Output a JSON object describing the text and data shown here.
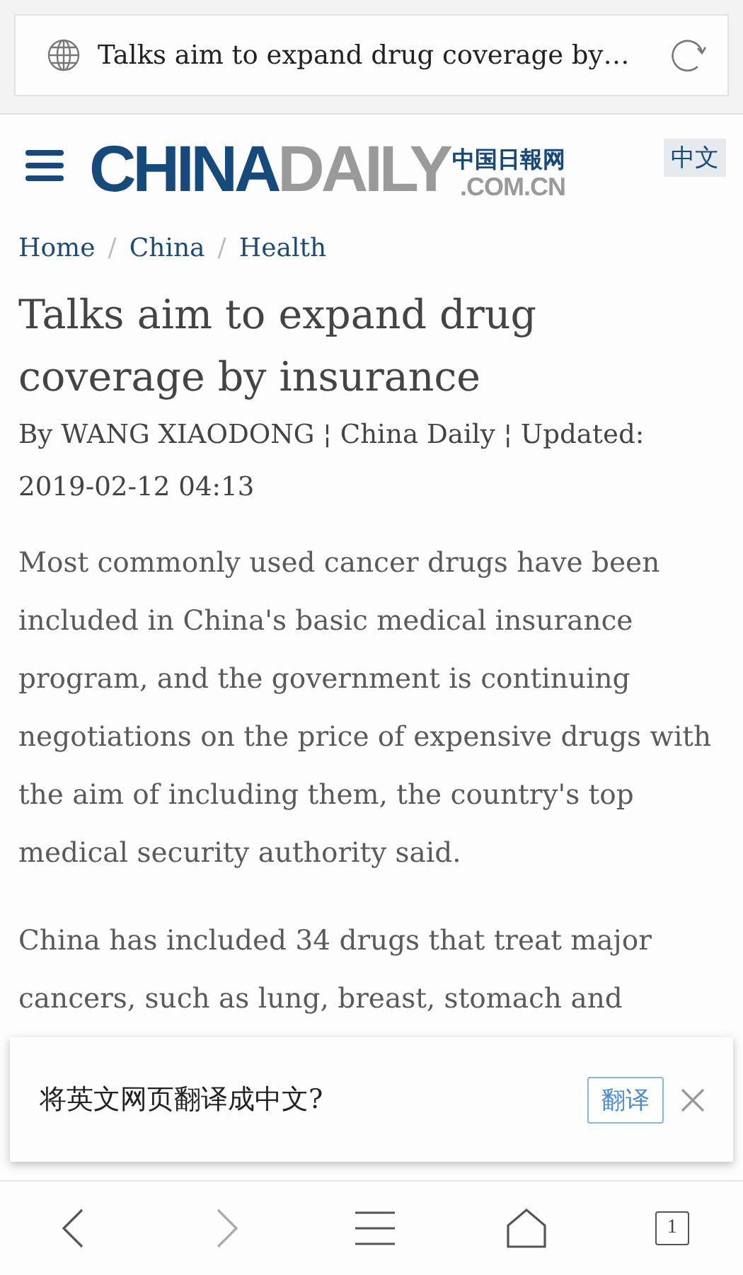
{
  "address_bar": {
    "title": "Talks aim to expand drug coverage by…"
  },
  "header": {
    "logo": {
      "primary": "CHINA",
      "secondary": "DAILY",
      "chinese": "中国日報网",
      "domain": ".COM.CN"
    },
    "language_button": "中文"
  },
  "breadcrumb": [
    {
      "label": "Home"
    },
    {
      "separator": "/",
      "label": "China"
    },
    {
      "separator": "/",
      "label": "Health"
    }
  ],
  "article": {
    "title": "Talks aim to expand drug coverage by insurance",
    "byline": "By WANG XIAODONG ¦ China Daily ¦ Updated: 2019-02-12 04:13",
    "paragraphs": [
      "Most commonly used cancer drugs have been included in China's basic medical insurance program, and the government is continuing negotiations on the price of expensive drugs with the aim of including them, the country's top medical security authority said.",
      "China has included 34 drugs that treat major cancers, such as lung, breast, stomach and"
    ]
  },
  "translate_prompt": {
    "message": "将英文网页翻译成中文?",
    "button": "翻译"
  },
  "toolbar": {
    "back": {
      "disabled": false
    },
    "forward": {
      "disabled": true
    },
    "tab_count": "1"
  }
}
